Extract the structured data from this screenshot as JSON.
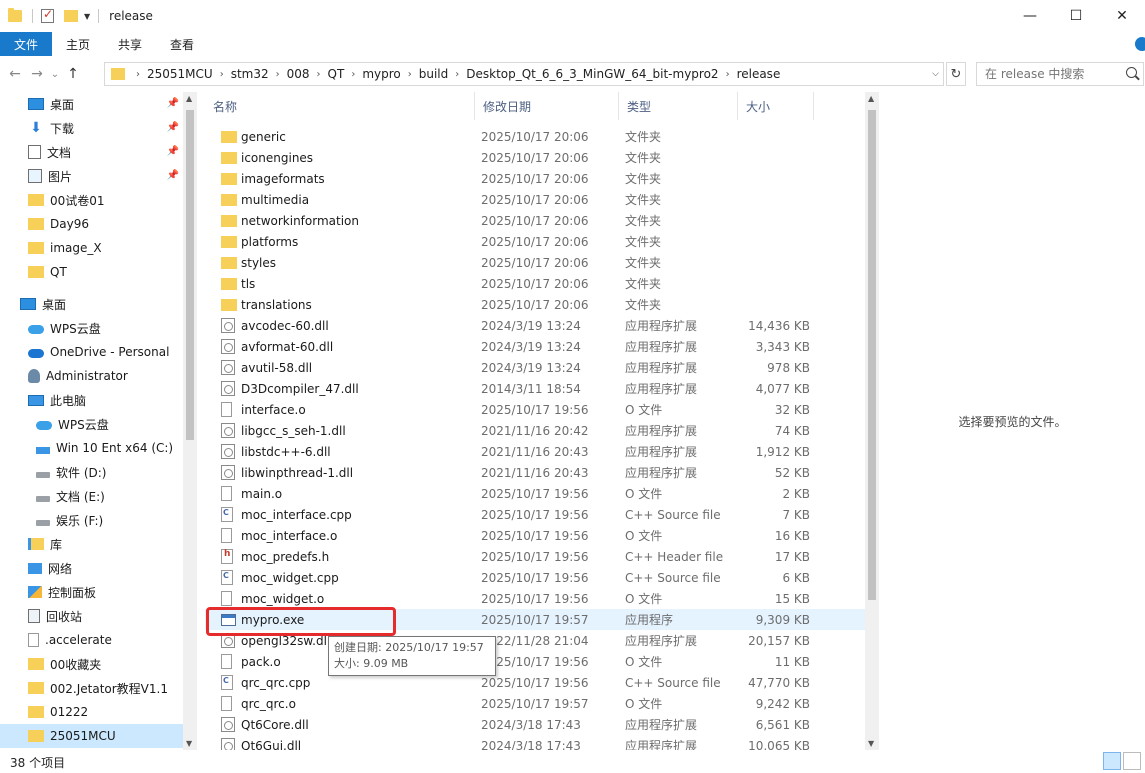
{
  "window": {
    "title": "release",
    "minimize": "—",
    "maximize": "☐",
    "close": "✕"
  },
  "ribbon": {
    "tabs": [
      "文件",
      "主页",
      "共享",
      "查看"
    ]
  },
  "nav": {
    "back": "←",
    "forward": "→",
    "recent": "⌄",
    "up": "↑"
  },
  "address": {
    "crumbs": [
      "25051MCU",
      "stm32",
      "008",
      "QT",
      "mypro",
      "build",
      "Desktop_Qt_6_6_3_MinGW_64_bit-mypro2",
      "release"
    ]
  },
  "search": {
    "placeholder": "在 release 中搜索"
  },
  "navpane": {
    "items": [
      {
        "label": "桌面",
        "icon": "desktop-icon",
        "pinned": true
      },
      {
        "label": "下载",
        "icon": "download-icon",
        "pinned": true
      },
      {
        "label": "文档",
        "icon": "document-icon",
        "pinned": true
      },
      {
        "label": "图片",
        "icon": "picture-icon",
        "pinned": true
      },
      {
        "label": "00试卷01",
        "icon": "folder-icon"
      },
      {
        "label": "Day96",
        "icon": "folder-icon"
      },
      {
        "label": "image_X",
        "icon": "folder-icon"
      },
      {
        "label": "QT",
        "icon": "folder-icon"
      },
      {
        "label": "桌面",
        "icon": "desktop-icon"
      },
      {
        "label": "WPS云盘",
        "icon": "cloud-icon"
      },
      {
        "label": "OneDrive - Personal",
        "icon": "onedrive-icon"
      },
      {
        "label": "Administrator",
        "icon": "user-icon"
      },
      {
        "label": "此电脑",
        "icon": "pc-icon"
      },
      {
        "label": "WPS云盘",
        "icon": "cloud-icon"
      },
      {
        "label": "Win 10 Ent x64 (C:)",
        "icon": "windows-drive-icon"
      },
      {
        "label": "软件 (D:)",
        "icon": "drive-icon"
      },
      {
        "label": "文档 (E:)",
        "icon": "drive-icon"
      },
      {
        "label": "娱乐 (F:)",
        "icon": "drive-icon"
      },
      {
        "label": "库",
        "icon": "library-icon"
      },
      {
        "label": "网络",
        "icon": "network-icon"
      },
      {
        "label": "控制面板",
        "icon": "control-panel-icon"
      },
      {
        "label": "回收站",
        "icon": "recycle-bin-icon"
      },
      {
        "label": ".accelerate",
        "icon": "file-icon"
      },
      {
        "label": "00收藏夹",
        "icon": "folder-icon"
      },
      {
        "label": "002.Jetator教程V1.1",
        "icon": "folder-icon"
      },
      {
        "label": "01222",
        "icon": "folder-icon"
      },
      {
        "label": "25051MCU",
        "icon": "folder-icon",
        "selected": true
      }
    ]
  },
  "columns": {
    "name": "名称",
    "date": "修改日期",
    "type": "类型",
    "size": "大小"
  },
  "files": [
    {
      "name": "generic",
      "date": "2025/10/17 20:06",
      "type": "文件夹",
      "size": "",
      "icon": "folder"
    },
    {
      "name": "iconengines",
      "date": "2025/10/17 20:06",
      "type": "文件夹",
      "size": "",
      "icon": "folder"
    },
    {
      "name": "imageformats",
      "date": "2025/10/17 20:06",
      "type": "文件夹",
      "size": "",
      "icon": "folder"
    },
    {
      "name": "multimedia",
      "date": "2025/10/17 20:06",
      "type": "文件夹",
      "size": "",
      "icon": "folder"
    },
    {
      "name": "networkinformation",
      "date": "2025/10/17 20:06",
      "type": "文件夹",
      "size": "",
      "icon": "folder"
    },
    {
      "name": "platforms",
      "date": "2025/10/17 20:06",
      "type": "文件夹",
      "size": "",
      "icon": "folder"
    },
    {
      "name": "styles",
      "date": "2025/10/17 20:06",
      "type": "文件夹",
      "size": "",
      "icon": "folder"
    },
    {
      "name": "tls",
      "date": "2025/10/17 20:06",
      "type": "文件夹",
      "size": "",
      "icon": "folder"
    },
    {
      "name": "translations",
      "date": "2025/10/17 20:06",
      "type": "文件夹",
      "size": "",
      "icon": "folder"
    },
    {
      "name": "avcodec-60.dll",
      "date": "2024/3/19 13:24",
      "type": "应用程序扩展",
      "size": "14,436 KB",
      "icon": "dll"
    },
    {
      "name": "avformat-60.dll",
      "date": "2024/3/19 13:24",
      "type": "应用程序扩展",
      "size": "3,343 KB",
      "icon": "dll"
    },
    {
      "name": "avutil-58.dll",
      "date": "2024/3/19 13:24",
      "type": "应用程序扩展",
      "size": "978 KB",
      "icon": "dll"
    },
    {
      "name": "D3Dcompiler_47.dll",
      "date": "2014/3/11 18:54",
      "type": "应用程序扩展",
      "size": "4,077 KB",
      "icon": "dll"
    },
    {
      "name": "interface.o",
      "date": "2025/10/17 19:56",
      "type": "O 文件",
      "size": "32 KB",
      "icon": "plain"
    },
    {
      "name": "libgcc_s_seh-1.dll",
      "date": "2021/11/16 20:42",
      "type": "应用程序扩展",
      "size": "74 KB",
      "icon": "dll"
    },
    {
      "name": "libstdc++-6.dll",
      "date": "2021/11/16 20:43",
      "type": "应用程序扩展",
      "size": "1,912 KB",
      "icon": "dll"
    },
    {
      "name": "libwinpthread-1.dll",
      "date": "2021/11/16 20:43",
      "type": "应用程序扩展",
      "size": "52 KB",
      "icon": "dll"
    },
    {
      "name": "main.o",
      "date": "2025/10/17 19:56",
      "type": "O 文件",
      "size": "2 KB",
      "icon": "plain"
    },
    {
      "name": "moc_interface.cpp",
      "date": "2025/10/17 19:56",
      "type": "C++ Source file",
      "size": "7 KB",
      "icon": "cpp"
    },
    {
      "name": "moc_interface.o",
      "date": "2025/10/17 19:56",
      "type": "O 文件",
      "size": "16 KB",
      "icon": "plain"
    },
    {
      "name": "moc_predefs.h",
      "date": "2025/10/17 19:56",
      "type": "C++ Header file",
      "size": "17 KB",
      "icon": "hdr"
    },
    {
      "name": "moc_widget.cpp",
      "date": "2025/10/17 19:56",
      "type": "C++ Source file",
      "size": "6 KB",
      "icon": "cpp"
    },
    {
      "name": "moc_widget.o",
      "date": "2025/10/17 19:56",
      "type": "O 文件",
      "size": "15 KB",
      "icon": "plain"
    },
    {
      "name": "mypro.exe",
      "date": "2025/10/17 19:57",
      "type": "应用程序",
      "size": "9,309 KB",
      "icon": "exe",
      "hover": true
    },
    {
      "name": "opengl32sw.dll",
      "date": "2022/11/28 21:04",
      "type": "应用程序扩展",
      "size": "20,157 KB",
      "icon": "dll"
    },
    {
      "name": "pack.o",
      "date": "2025/10/17 19:56",
      "type": "O 文件",
      "size": "11 KB",
      "icon": "plain"
    },
    {
      "name": "qrc_qrc.cpp",
      "date": "2025/10/17 19:56",
      "type": "C++ Source file",
      "size": "47,770 KB",
      "icon": "cpp"
    },
    {
      "name": "qrc_qrc.o",
      "date": "2025/10/17 19:57",
      "type": "O 文件",
      "size": "9,242 KB",
      "icon": "plain"
    },
    {
      "name": "Qt6Core.dll",
      "date": "2024/3/18 17:43",
      "type": "应用程序扩展",
      "size": "6,561 KB",
      "icon": "dll"
    },
    {
      "name": "Qt6Gui.dll",
      "date": "2024/3/18 17:43",
      "type": "应用程序扩展",
      "size": "10,065 KB",
      "icon": "dll"
    }
  ],
  "tooltip": {
    "created": "创建日期: 2025/10/17 19:57",
    "size": "大小: 9.09 MB"
  },
  "preview": {
    "message": "选择要预览的文件。"
  },
  "status": {
    "count": "38 个项目"
  }
}
